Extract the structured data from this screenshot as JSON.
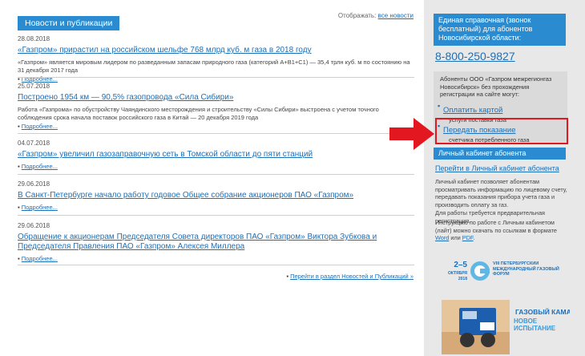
{
  "news": {
    "header": "Новости и публикации",
    "display_label": "Отображать:",
    "display_value": "все новости",
    "more_label": "Подробнее...",
    "items": [
      {
        "date": "28.08.2018",
        "title": "«Газпром» прирастил на российском шельфе 768 млрд куб. м газа в 2018 году",
        "excerpt": "«Газпром» является мировым лидером по разведанным запасам природного газа (категорий A+B1+C1) — 35,4 трлн куб. м по состоянию на 31 декабря 2017 года"
      },
      {
        "date": "25.07.2018",
        "title": "Построено 1954 км — 90,5% газопровода «Сила Сибири»",
        "excerpt": "Работа «Газпрома» по обустройству Чаяндинского месторождения и строительству «Силы Сибири» выстроена с учетом точного соблюдения срока начала поставок российского газа в Китай — 20 декабря 2019 года"
      },
      {
        "date": "04.07.2018",
        "title": "«Газпром» увеличил газозаправочную сеть в Томской области до пяти станций",
        "excerpt": ""
      },
      {
        "date": "29.06.2018",
        "title": "В Санкт-Петербурге начало работу годовое Общее собрание акционеров ПАО «Газпром»",
        "excerpt": ""
      },
      {
        "date": "29.06.2018",
        "title": "Обращение к акционерам Председателя Совета директоров ПАО «Газпром» Виктора Зубкова и Председателя Правления ПАО «Газпром» Алексея Миллера",
        "excerpt": ""
      }
    ],
    "all_news_link": "Перейти в раздел Новостей и Публикаций »"
  },
  "sidebar": {
    "hotline_title": "Единая справочная (звонок бесплатный) для абонентов Новосибирской области:",
    "phone": "8-800-250-9827",
    "services_intro": "Абоненты ООО «Газпром межрегионгаз Новосибирск» без прохождения регистрации на сайте могут:",
    "services": [
      {
        "link": "Оплатить картой",
        "sub": "услуги поставки газа"
      },
      {
        "link": "Передать показание",
        "sub": "счетчика потребленного газа"
      }
    ],
    "cabinet_header": "Личный кабинет абонента",
    "cabinet_link": "Перейти в Личный кабинет абонента",
    "cabinet_desc": "Личный кабинет позволяет абонентам просматривать информацию по лицевому счету, передавать показания прибора учета газа и производить оплату за газ.",
    "cabinet_reg": "Для работы требуется предварительная регистрация.",
    "cabinet_instr_prefix": "Инструкцию по работе с Личным кабинетом (лайт) можно скачать по ссылкам в формате",
    "cabinet_instr_word": "Word",
    "cabinet_instr_or": "или",
    "cabinet_instr_pdf": "PDF"
  },
  "banners": {
    "forum_dates": "2–5",
    "forum_month": "ОКТЯБРЯ",
    "forum_year": "2018",
    "forum_title": "VIII ПЕТЕРБУРГСКИЙ МЕЖДУНАРОДНЫЙ ГАЗОВЫЙ ФОРУМ",
    "kamaz_title": "ГАЗОВЫЙ КАМАЗ:",
    "kamaz_sub": "НОВОЕ ИСПЫТАНИЕ"
  },
  "colors": {
    "accent_blue": "#2a8bd1",
    "link_blue": "#1d6fb8",
    "highlight_red": "#e2171f",
    "sidebar_bg": "#e8e8e8"
  }
}
